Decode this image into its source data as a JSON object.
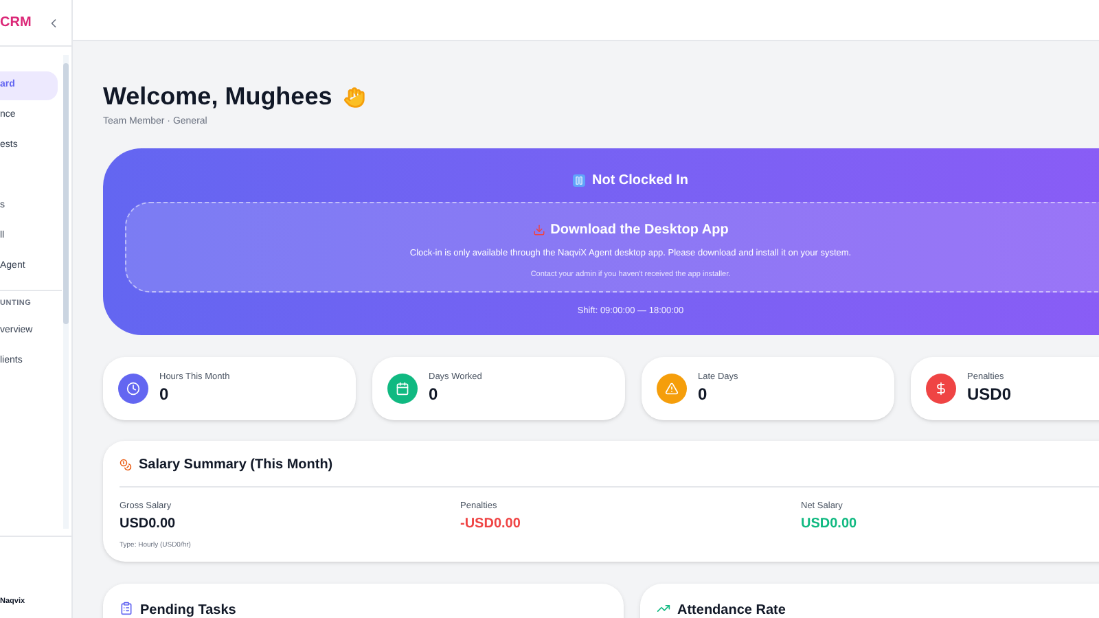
{
  "sidebar": {
    "brand": "CRM",
    "items": [
      {
        "label": "ard",
        "selected": true
      },
      {
        "label": "nce",
        "selected": false
      },
      {
        "label": "ests",
        "selected": false
      },
      {
        "label": "s",
        "selected": false
      },
      {
        "label": "ll",
        "selected": false
      },
      {
        "label": "Agent",
        "selected": false
      }
    ],
    "section": "UNTING",
    "section_items": [
      {
        "label": "verview",
        "selected": false
      },
      {
        "label": "lients",
        "selected": false
      }
    ],
    "footer": "Naqvix"
  },
  "welcome": {
    "title": "Welcome, Mughees",
    "subtitle": "Team Member · General"
  },
  "clock": {
    "status": "Not Clocked In",
    "download_title": "Download the Desktop App",
    "message": "Clock-in is only available through the NaqviX Agent desktop app. Please download and install it on your system.",
    "note": "Contact your admin if you haven't received the app installer.",
    "shift": "Shift: 09:00:00 — 18:00:00"
  },
  "stats": [
    {
      "kind": "clock",
      "label": "Hours This Month",
      "value": "0",
      "color": "#6366f1"
    },
    {
      "kind": "calendar",
      "label": "Days Worked",
      "value": "0",
      "color": "#10b981"
    },
    {
      "kind": "warning",
      "label": "Late Days",
      "value": "0",
      "color": "#f59e0b"
    },
    {
      "kind": "dollar",
      "label": "Penalties",
      "value": "USD0",
      "color": "#ef4444"
    }
  ],
  "salary": {
    "title": "Salary Summary (This Month)",
    "items": [
      {
        "kind": "neutral",
        "label": "Gross Salary",
        "value": "USD0.00",
        "note": "Type: Hourly (USD0/hr)"
      },
      {
        "kind": "negative",
        "label": "Penalties",
        "value": "-USD0.00"
      },
      {
        "kind": "positive",
        "label": "Net Salary",
        "value": "USD0.00"
      }
    ]
  },
  "panels": [
    {
      "kind": "tasks",
      "title": "Pending Tasks"
    },
    {
      "kind": "trend",
      "title": "Attendance Rate"
    }
  ]
}
